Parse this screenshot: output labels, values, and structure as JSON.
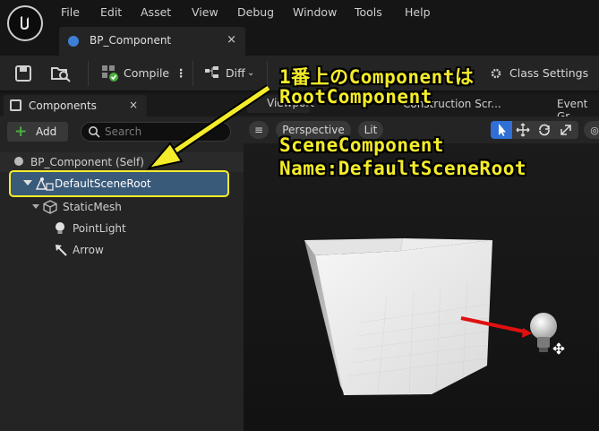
{
  "menubar": {
    "items": [
      "File",
      "Edit",
      "Asset",
      "View",
      "Debug",
      "Window",
      "Tools",
      "Help"
    ]
  },
  "document_tab": {
    "label": "BP_Component",
    "close": "×"
  },
  "toolbar": {
    "compile_label": "Compile",
    "more_label": "⋮",
    "diff_label": "Diff",
    "class_settings_label": "Class Settings"
  },
  "components_panel": {
    "tab_label": "Components",
    "close": "×",
    "add_label": "Add",
    "search_placeholder": "Search",
    "tree": [
      {
        "label": "BP_Component (Self)"
      },
      {
        "label": "DefaultSceneRoot"
      },
      {
        "label": "StaticMesh"
      },
      {
        "label": "PointLight"
      },
      {
        "label": "Arrow"
      }
    ]
  },
  "viewport_panel": {
    "tabs": [
      "Viewport",
      "Construction Scr...",
      "Event Gr"
    ],
    "perspective_label": "Perspective",
    "lit_label": "Lit"
  },
  "annotation": {
    "line1": "1番上のComponentは",
    "line2": "RootComponent",
    "line3": "SceneComponent",
    "line4": "Name:DefaultSceneRoot"
  },
  "colors": {
    "annotation": "#f4ec2a",
    "selection": "#3a5a7a",
    "add_plus": "#4caf3f",
    "arrow_component": "#e01010",
    "active_tool": "#2f6fd6"
  }
}
